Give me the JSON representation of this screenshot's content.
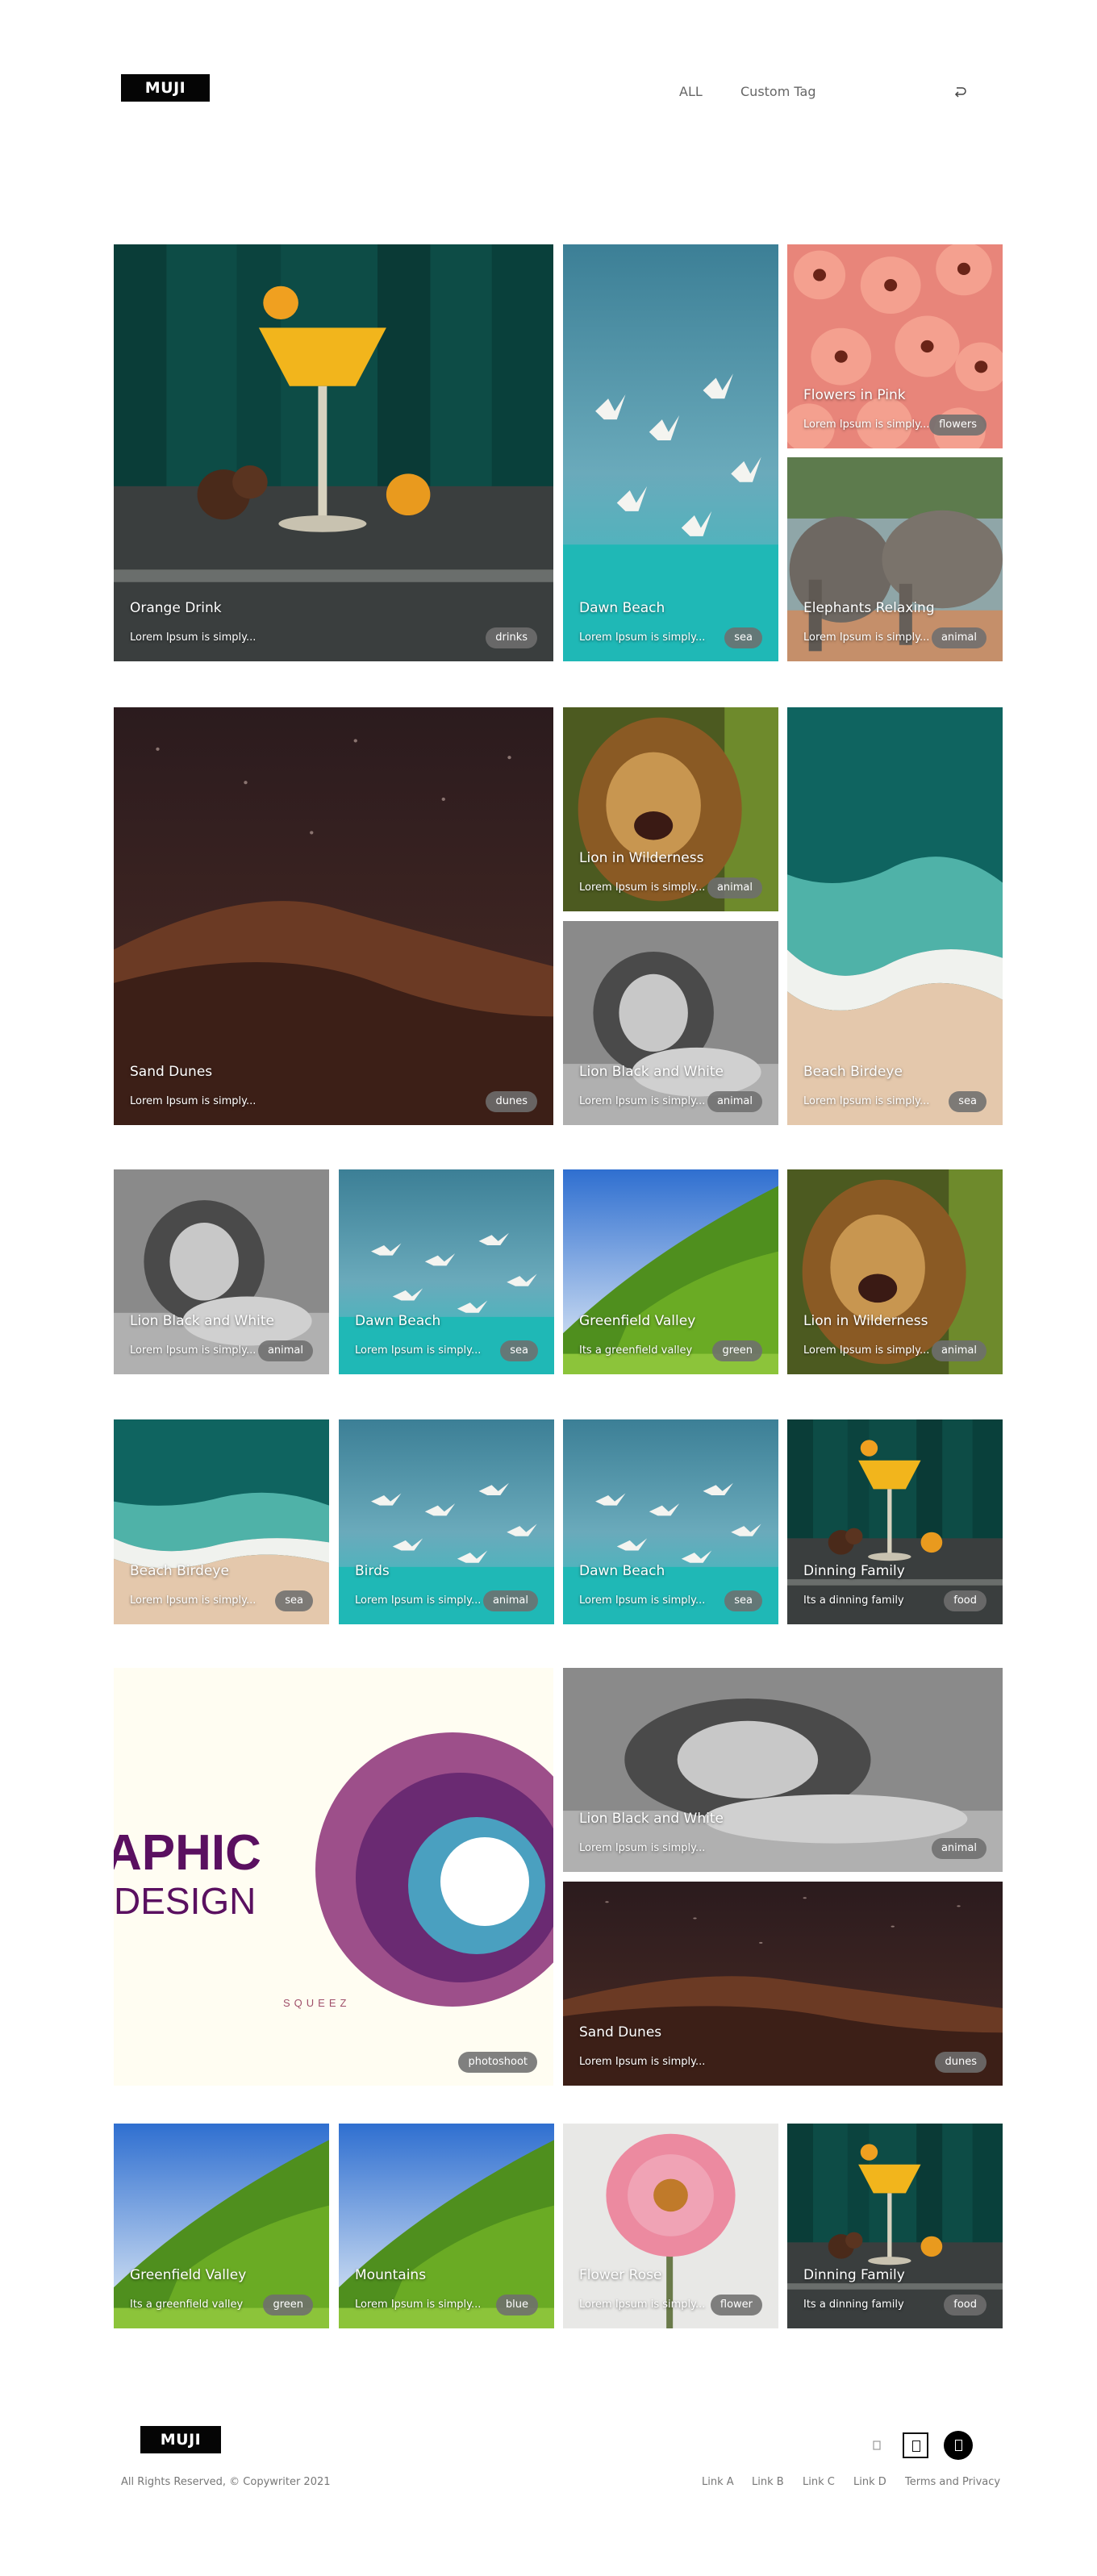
{
  "header": {
    "logo": "MUJI",
    "nav": [
      "ALL",
      "Custom Tag"
    ]
  },
  "footer": {
    "logo": "MUJI",
    "copyright": "All Rights Reserved, © Copywriter 2021",
    "links": [
      "Link A",
      "Link B",
      "Link C",
      "Link D",
      "Terms and Privacy"
    ]
  },
  "gallery": [
    {
      "title": "Orange Drink",
      "desc": "Lorem Ipsum is simply...",
      "tag": "drinks",
      "scene": "drink"
    },
    {
      "title": "Dawn Beach",
      "desc": "Lorem Ipsum is simply...",
      "tag": "sea",
      "scene": "birds"
    },
    {
      "title": "Flowers in Pink",
      "desc": "Lorem Ipsum is simply...",
      "tag": "flowers",
      "scene": "flowers"
    },
    {
      "title": "Elephants Relaxing",
      "desc": "Lorem Ipsum is simply...",
      "tag": "animal",
      "scene": "elephants"
    },
    {
      "title": "Sand Dunes",
      "desc": "Lorem Ipsum is simply...",
      "tag": "dunes",
      "scene": "dunes"
    },
    {
      "title": "Lion in Wilderness",
      "desc": "Lorem Ipsum is simply...",
      "tag": "animal",
      "scene": "lion"
    },
    {
      "title": "Lion Black and White",
      "desc": "Lorem Ipsum is simply...",
      "tag": "animal",
      "scene": "lionbw"
    },
    {
      "title": "Beach Birdeye",
      "desc": "Lorem Ipsum is simply...",
      "tag": "sea",
      "scene": "beach"
    },
    {
      "title": "Lion Black and White",
      "desc": "Lorem Ipsum is simply...",
      "tag": "animal",
      "scene": "lionbw"
    },
    {
      "title": "Dawn Beach",
      "desc": "Lorem Ipsum is simply...",
      "tag": "sea",
      "scene": "birds"
    },
    {
      "title": "Greenfield Valley",
      "desc": "Its a greenfield valley",
      "tag": "green",
      "scene": "valley"
    },
    {
      "title": "Lion in Wilderness",
      "desc": "Lorem Ipsum is simply...",
      "tag": "animal",
      "scene": "lion"
    },
    {
      "title": "Beach Birdeye",
      "desc": "Lorem Ipsum is simply...",
      "tag": "sea",
      "scene": "beach"
    },
    {
      "title": "Birds",
      "desc": "Lorem Ipsum is simply...",
      "tag": "animal",
      "scene": "birds"
    },
    {
      "title": "Dawn Beach",
      "desc": "Lorem Ipsum is simply...",
      "tag": "sea",
      "scene": "birds"
    },
    {
      "title": "Dinning Family",
      "desc": "Its a dinning family",
      "tag": "food",
      "scene": "drink"
    },
    {
      "title": "",
      "desc": "",
      "tag": "photoshoot",
      "scene": "design",
      "artwork": [
        "APHIC",
        "DESIGN",
        "SQUEEZ"
      ]
    },
    {
      "title": "Lion Black and White",
      "desc": "Lorem Ipsum is simply...",
      "tag": "animal",
      "scene": "lionbw"
    },
    {
      "title": "Sand Dunes",
      "desc": "Lorem Ipsum is simply...",
      "tag": "dunes",
      "scene": "dunes"
    },
    {
      "title": "Greenfield Valley",
      "desc": "Its a greenfield valley",
      "tag": "green",
      "scene": "valley"
    },
    {
      "title": "Mountains",
      "desc": "Lorem Ipsum is simply...",
      "tag": "blue",
      "scene": "valley"
    },
    {
      "title": "Flower Rose",
      "desc": "Lorem Ipsum is simply...",
      "tag": "flower",
      "scene": "rose"
    },
    {
      "title": "Dinning Family",
      "desc": "Its a dinning family",
      "tag": "food",
      "scene": "drink"
    }
  ]
}
